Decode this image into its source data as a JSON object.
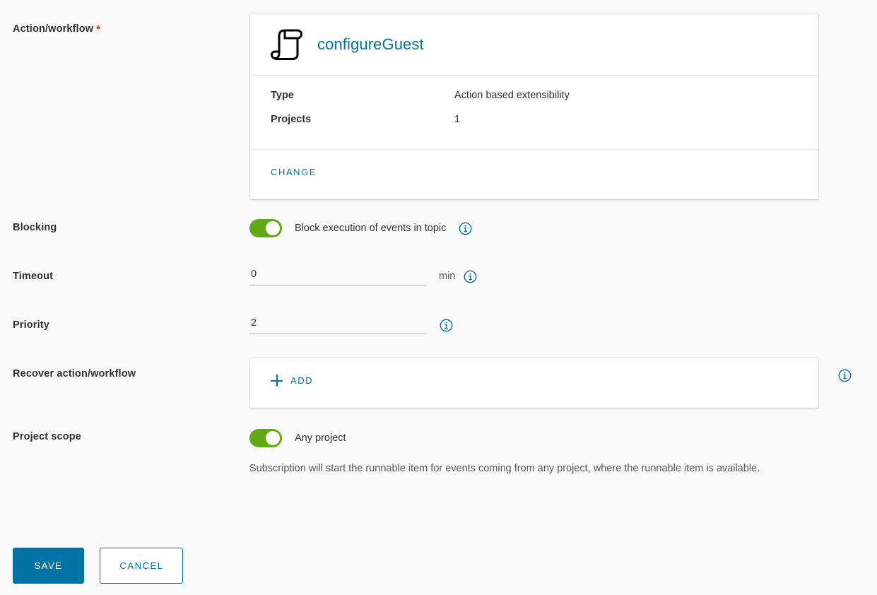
{
  "form": {
    "action_workflow": {
      "label": "Action/workflow",
      "required_marker": "*",
      "icon": "script-scroll-icon",
      "title": "configureGuest",
      "details": [
        {
          "key": "Type",
          "value": "Action based extensibility"
        },
        {
          "key": "Projects",
          "value": "1"
        }
      ],
      "change_label": "CHANGE"
    },
    "blocking": {
      "label": "Blocking",
      "toggle_on": true,
      "toggle_label": "Block execution of events in topic",
      "info_icon": "info-circle-icon"
    },
    "timeout": {
      "label": "Timeout",
      "value": "0",
      "placeholder": "",
      "unit": "min",
      "info_icon": "info-circle-icon"
    },
    "priority": {
      "label": "Priority",
      "value": "2",
      "placeholder": "",
      "info_icon": "info-circle-icon"
    },
    "recover": {
      "label": "Recover action/workflow",
      "add_label": "ADD",
      "add_icon": "plus-icon",
      "info_icon": "info-circle-icon"
    },
    "project_scope": {
      "label": "Project scope",
      "toggle_on": true,
      "toggle_label": "Any project",
      "description": "Subscription will start the runnable item for events coming from any project, where the runnable item is available."
    }
  },
  "actions": {
    "save_label": "SAVE",
    "cancel_label": "CANCEL"
  },
  "colors": {
    "accent": "#0072a3",
    "toggle_on": "#60a917",
    "required": "#e62700",
    "page_bg": "#fafafa",
    "card_bg": "#ffffff",
    "text": "#313131"
  }
}
